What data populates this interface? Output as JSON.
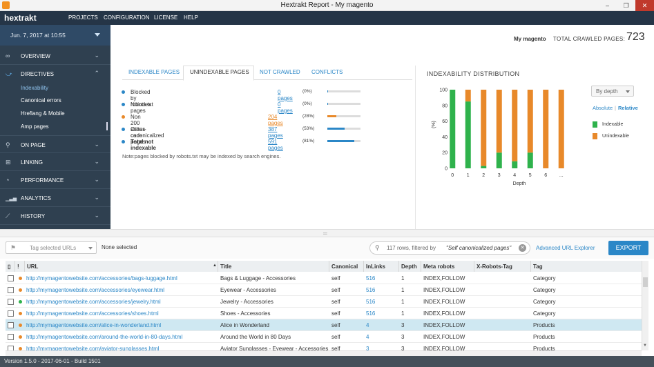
{
  "window": {
    "title": "Hextrakt Report - My magento",
    "app_icon": "app-icon",
    "controls": [
      "–",
      "❐",
      "✕"
    ]
  },
  "nav": {
    "logo": "hextrakt",
    "items": [
      "PROJECTS",
      "CONFIGURATION",
      "LICENSE",
      "HELP"
    ]
  },
  "sidebar": {
    "date": "Jun. 7, 2017 at 10:55",
    "sections": [
      {
        "label": "OVERVIEW",
        "icon": "overview-icon",
        "glyph": "∞",
        "chevron": "⌄"
      },
      {
        "label": "DIRECTIVES",
        "icon": "directives-icon",
        "glyph": "⤻",
        "chevron": "⌃"
      },
      {
        "label": "ON PAGE",
        "icon": "search-icon",
        "glyph": "⚲",
        "chevron": "⌄"
      },
      {
        "label": "LINKING",
        "icon": "linking-icon",
        "glyph": "⊞",
        "chevron": "⌄"
      },
      {
        "label": "PERFORMANCE",
        "icon": "gauge-icon",
        "glyph": "◔",
        "chevron": "⌄"
      },
      {
        "label": "ANALYTICS",
        "icon": "analytics-icon",
        "glyph": "▁▃▅",
        "chevron": "⌄"
      },
      {
        "label": "HISTORY",
        "icon": "history-icon",
        "glyph": "⟋",
        "chevron": "⌄"
      }
    ],
    "directives_items": [
      "Indexability",
      "Canonical errors",
      "Hreflang & Mobile",
      "Amp pages"
    ]
  },
  "header": {
    "project": "My magento",
    "crawled_label": "TOTAL CRAWLED PAGES:",
    "crawled_value": "723"
  },
  "tabs": [
    "INDEXABLE PAGES",
    "UNINDEXABLE PAGES",
    "NOT CRAWLED",
    "CONFLICTS"
  ],
  "unindexable": [
    {
      "label": "Blocked by robots.txt",
      "count": "0 pages",
      "pct": "(0%)",
      "fill": 0,
      "color": "#2b87c7"
    },
    {
      "label": "Noindex pages",
      "count": "0 pages",
      "pct": "(0%)",
      "fill": 0,
      "color": "#2b87c7"
    },
    {
      "label": "Non 200 status code",
      "count": "204 pages",
      "pct": "(28%)",
      "fill": 0.28,
      "color": "#e8892a"
    },
    {
      "label": "Other-canonicalized pages",
      "count": "387 pages",
      "pct": "(53%)",
      "fill": 0.53,
      "color": "#2b87c7"
    },
    {
      "label": "Total not indexable",
      "count": "591 pages",
      "pct": "(81%)",
      "fill": 0.81,
      "color": "#2b87c7"
    }
  ],
  "note": "Note:pages blocked by robots.txt may be indexed by search engines.",
  "chart": {
    "title": "INDEXABILITY DISTRIBUTION",
    "depth_select": "By depth",
    "absolute": "Absolute",
    "relative": "Relative",
    "legend": [
      "Indexable",
      "Unindexable"
    ]
  },
  "chart_data": {
    "type": "bar",
    "categories": [
      "0",
      "1",
      "2",
      "3",
      "4",
      "5",
      "6",
      "..."
    ],
    "series": [
      {
        "name": "Indexable",
        "color": "#2fb24c",
        "values": [
          100,
          85,
          3,
          20,
          9,
          20,
          0,
          0
        ]
      },
      {
        "name": "Unindexable",
        "color": "#e8892a",
        "values": [
          0,
          15,
          97,
          80,
          91,
          80,
          100,
          100
        ]
      }
    ],
    "yticks": [
      "0",
      "20",
      "40",
      "60",
      "80",
      "100"
    ],
    "xlabel": "Depth",
    "ylabel": "(%)",
    "ylim": [
      0,
      100
    ]
  },
  "toolbar": {
    "tag_placeholder": "Tag selected URLs",
    "none_selected": "None selected",
    "rows_filter": "117 rows, filtered by",
    "filter_value": "\"Self canonicalized pages\"",
    "advanced": "Advanced URL Explorer",
    "export": "EXPORT"
  },
  "table": {
    "columns": [
      "▯",
      "!",
      "URL",
      "Title",
      "Canonical",
      "InLinks",
      "Depth",
      "Meta robots",
      "X-Robots-Tag",
      "Tag"
    ],
    "rows": [
      {
        "status": "#e8892a",
        "url": "http://mymagentowebsite.com/accessories/bags-luggage.html",
        "title": "Bags & Luggage - Accessories",
        "canonical": "self",
        "inlinks": "516",
        "depth": "1",
        "meta": "INDEX,FOLLOW",
        "xrobots": "",
        "tag": "Category"
      },
      {
        "status": "#e8892a",
        "url": "http://mymagentowebsite.com/accessories/eyewear.html",
        "title": "Eyewear - Accessories",
        "canonical": "self",
        "inlinks": "516",
        "depth": "1",
        "meta": "INDEX,FOLLOW",
        "xrobots": "",
        "tag": "Category"
      },
      {
        "status": "#2fb24c",
        "url": "http://mymagentowebsite.com/accessories/jewelry.html",
        "title": "Jewelry - Accessories",
        "canonical": "self",
        "inlinks": "516",
        "depth": "1",
        "meta": "INDEX,FOLLOW",
        "xrobots": "",
        "tag": "Category"
      },
      {
        "status": "#e8892a",
        "url": "http://mymagentowebsite.com/accessories/shoes.html",
        "title": "Shoes - Accessories",
        "canonical": "self",
        "inlinks": "516",
        "depth": "1",
        "meta": "INDEX,FOLLOW",
        "xrobots": "",
        "tag": "Category"
      },
      {
        "status": "#e8892a",
        "url": "http://mymagentowebsite.com/alice-in-wonderland.html",
        "title": "Alice in Wonderland",
        "canonical": "self",
        "inlinks": "4",
        "depth": "3",
        "meta": "INDEX,FOLLOW",
        "xrobots": "",
        "tag": "Products"
      },
      {
        "status": "#e8892a",
        "url": "http://mymagentowebsite.com/around-the-world-in-80-days.html",
        "title": "Around the World in 80 Days",
        "canonical": "self",
        "inlinks": "4",
        "depth": "3",
        "meta": "INDEX,FOLLOW",
        "xrobots": "",
        "tag": "Products"
      },
      {
        "status": "#e8892a",
        "url": "http://mymagentowebsite.com/aviator-sunglasses.html",
        "title": "Aviator Sunglasses - Eyewear - Accessories",
        "canonical": "self",
        "inlinks": "3",
        "depth": "3",
        "meta": "INDEX,FOLLOW",
        "xrobots": "",
        "tag": "Products"
      }
    ]
  },
  "status": "Version 1.5.0 - 2017-06-01 - Build 1501"
}
